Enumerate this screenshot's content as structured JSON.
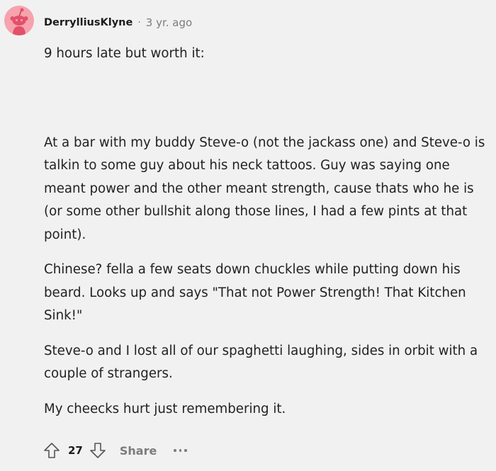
{
  "comment": {
    "author": "DerrylliusKlyne",
    "separator": "·",
    "age": "3 yr. ago",
    "paragraphs": [
      "9 hours late but worth it:",
      "At a bar with my buddy Steve-o (not the jackass one) and Steve-o is talkin to some guy about his neck tattoos. Guy was saying one meant power and the other meant strength, cause thats who he is (or some other bullshit along those lines, I had a few pints at that point).",
      "Chinese? fella a few seats down chuckles while putting down his beard. Looks up and says \"That not Power Strength! That Kitchen Sink!\"",
      "Steve-o and I lost all of our spaghetti laughing, sides in orbit with a couple of strangers.",
      "My cheecks hurt just remembering it."
    ],
    "actions": {
      "upvote_icon": "arrow-up-icon",
      "vote_count": "27",
      "downvote_icon": "arrow-down-icon",
      "share_label": "Share",
      "more_icon": "more-options-icon"
    }
  },
  "colors": {
    "background": "#f1f1f1",
    "avatar_bg": "#f5a3ad",
    "text": "#222222",
    "muted": "#7c7c7c"
  }
}
